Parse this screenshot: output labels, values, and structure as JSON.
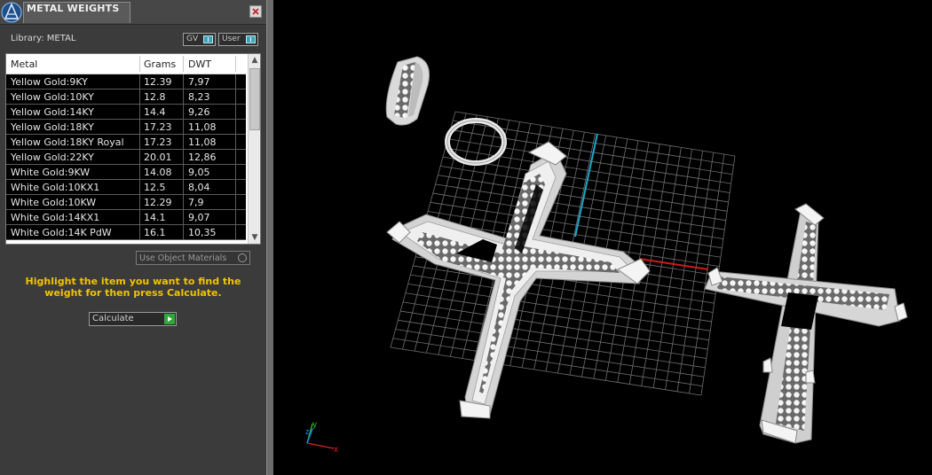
{
  "panel": {
    "title": "METAL WEIGHTS",
    "library_label": "Library: METAL",
    "toggles": [
      {
        "label": "GV"
      },
      {
        "label": "User"
      }
    ],
    "table": {
      "headers": [
        "Metal",
        "Grams",
        "DWT"
      ],
      "rows": [
        {
          "metal": "Yellow Gold:9KY",
          "grams": "12.39",
          "dwt": "7,97"
        },
        {
          "metal": "Yellow Gold:10KY",
          "grams": "12.8",
          "dwt": "8,23"
        },
        {
          "metal": "Yellow Gold:14KY",
          "grams": "14.4",
          "dwt": "9,26"
        },
        {
          "metal": "Yellow Gold:18KY",
          "grams": "17.23",
          "dwt": "11,08"
        },
        {
          "metal": "Yellow Gold:18KY Royal",
          "grams": "17.23",
          "dwt": "11,08"
        },
        {
          "metal": "Yellow Gold:22KY",
          "grams": "20.01",
          "dwt": "12,86"
        },
        {
          "metal": "White Gold:9KW",
          "grams": "14.08",
          "dwt": "9,05"
        },
        {
          "metal": "White Gold:10KX1",
          "grams": "12.5",
          "dwt": "8,04"
        },
        {
          "metal": "White Gold:10KW",
          "grams": "12.29",
          "dwt": "7,9"
        },
        {
          "metal": "White Gold:14KX1",
          "grams": "14.1",
          "dwt": "9,07"
        },
        {
          "metal": "White Gold:14K PdW",
          "grams": "16.1",
          "dwt": "10,35"
        }
      ]
    },
    "use_object_materials": "Use Object Materials",
    "instructions": "Highlight the item you want to find the weight for then press Calculate.",
    "calculate_label": "Calculate"
  },
  "viewport": {
    "axis_labels": {
      "x": "x",
      "y": "y",
      "z": "z"
    }
  },
  "colors": {
    "panel_bg": "#3b3b3b",
    "instruction_text": "#f2c400",
    "toggle_accent": "#3ea3b8",
    "axis_x": "#e02020",
    "axis_y": "#20c020",
    "axis_z": "#2080ff",
    "grid_axis_cyan": "#1aa6c8"
  }
}
